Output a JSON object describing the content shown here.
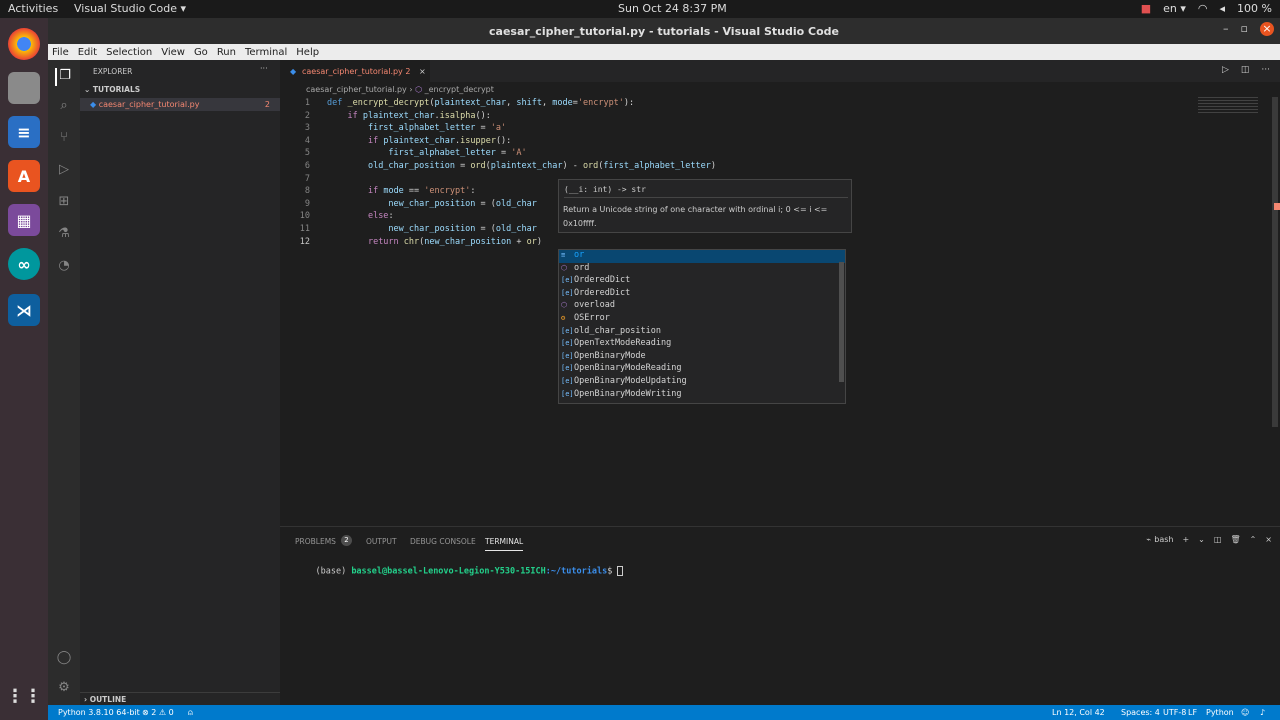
{
  "topbar": {
    "activities": "Activities",
    "app": "Visual Studio Code ▾",
    "clock": "Sun Oct 24   8:37 PM",
    "lang": "en ▾",
    "battery": "100 %"
  },
  "window": {
    "title": "caesar_cipher_tutorial.py - tutorials - Visual Studio Code"
  },
  "menu": [
    "File",
    "Edit",
    "Selection",
    "View",
    "Go",
    "Run",
    "Terminal",
    "Help"
  ],
  "sidebar": {
    "header": "EXPLORER",
    "folder": "TUTORIALS",
    "file": "caesar_cipher_tutorial.py",
    "file_badge": "2",
    "outline": "OUTLINE"
  },
  "editor": {
    "tab_label": "caesar_cipher_tutorial.py 2",
    "breadcrumb_file": "caesar_cipher_tutorial.py",
    "breadcrumb_symbol": "_encrypt_decrypt",
    "line_numbers": [
      "1",
      "2",
      "3",
      "4",
      "5",
      "6",
      "7",
      "8",
      "9",
      "10",
      "11",
      "12"
    ]
  },
  "hover": {
    "signature": "(__i: int) -> str",
    "doc_line1": "Return a Unicode string of one character with ordinal i; 0 <= i <=",
    "doc_line2": "0x10ffff."
  },
  "suggestions": [
    {
      "label": "or",
      "kind": "keyword-icon"
    },
    {
      "label": "ord",
      "kind": "method-icon"
    },
    {
      "label": "OrderedDict",
      "kind": "variable-icon"
    },
    {
      "label": "OrderedDict",
      "kind": "variable-icon"
    },
    {
      "label": "overload",
      "kind": "method-icon"
    },
    {
      "label": "OSError",
      "kind": "class-icon"
    },
    {
      "label": "old_char_position",
      "kind": "variable-icon"
    },
    {
      "label": "OpenTextModeReading",
      "kind": "variable-icon"
    },
    {
      "label": "OpenBinaryMode",
      "kind": "variable-icon"
    },
    {
      "label": "OpenBinaryModeReading",
      "kind": "variable-icon"
    },
    {
      "label": "OpenBinaryModeUpdating",
      "kind": "variable-icon"
    },
    {
      "label": "OpenBinaryModeWriting",
      "kind": "variable-icon"
    }
  ],
  "panel": {
    "tabs": [
      "PROBLEMS",
      "OUTPUT",
      "DEBUG CONSOLE",
      "TERMINAL"
    ],
    "problems_count": "2",
    "shell": "bash",
    "prompt_base": "(base) ",
    "prompt_user": "bassel@bassel-Lenovo-Legion-Y530-15ICH",
    "prompt_path": ":~/tutorials",
    "prompt_end": "$ "
  },
  "status": {
    "interpreter": "Python 3.8.10 64-bit",
    "problems": "⊗ 2 ⚠ 0",
    "position": "Ln 12, Col 42",
    "spaces": "Spaces: 4",
    "encoding": "UTF-8",
    "eol": "LF",
    "language": "Python"
  },
  "colors": {
    "accent": "#007acc",
    "error_tab": "#f48771",
    "selection": "#094771"
  }
}
